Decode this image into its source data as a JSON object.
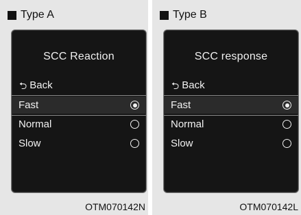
{
  "panels": [
    {
      "type_label": "Type A",
      "screen": {
        "title": "SCC Reaction",
        "back_label": "Back",
        "options": [
          {
            "label": "Fast",
            "selected": true
          },
          {
            "label": "Normal",
            "selected": false
          },
          {
            "label": "Slow",
            "selected": false
          }
        ]
      },
      "code": "OTM070142N"
    },
    {
      "type_label": "Type B",
      "screen": {
        "title": "SCC response",
        "back_label": "Back",
        "options": [
          {
            "label": "Fast",
            "selected": true
          },
          {
            "label": "Normal",
            "selected": false
          },
          {
            "label": "Slow",
            "selected": false
          }
        ]
      },
      "code": "OTM070142L"
    }
  ],
  "icons": {
    "back": "return-arrow-icon",
    "radio_on": "radio-selected-icon",
    "radio_off": "radio-unselected-icon"
  }
}
